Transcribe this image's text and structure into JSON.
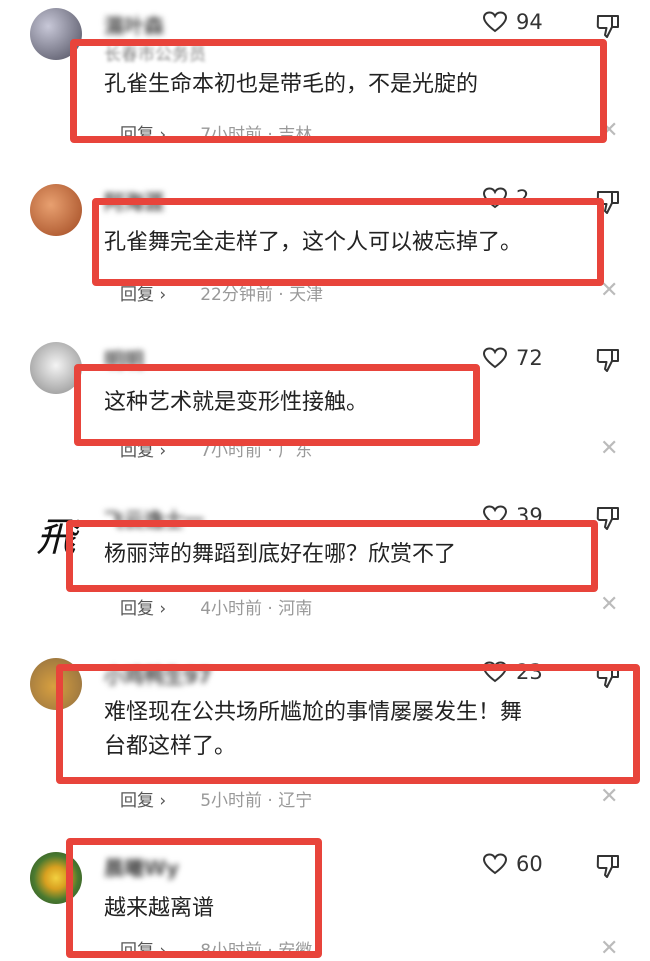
{
  "colors": {
    "highlight": "#e8443b",
    "text": "#222222",
    "meta": "#999999"
  },
  "icons": {
    "like": "heart-icon",
    "dislike": "thumbs-down-icon",
    "close": "close-icon",
    "reply_arrow": "chevron-right-icon"
  },
  "comments": [
    {
      "username": "濕叶森",
      "tag": "长春市公务员",
      "likes": "94",
      "text_lines": [
        "孔雀生命本初也是带毛的，不是光腚的"
      ],
      "reply_label": "回复 ›",
      "time": "7小时前",
      "location": "吉林"
    },
    {
      "username": "阿海涯",
      "tag": "",
      "likes": "2",
      "text_lines": [
        "孔雀舞完全走样了，这个人可以被忘掉了。"
      ],
      "reply_label": "回复 ›",
      "time": "22分钟前",
      "location": "天津"
    },
    {
      "username": "明明",
      "tag": "",
      "likes": "72",
      "text_lines": [
        "这种艺术就是变形性接触。"
      ],
      "reply_label": "回复 ›",
      "time": "7小时前",
      "location": "广东"
    },
    {
      "username": "飞云逸士一",
      "tag": "",
      "likes": "39",
      "text_lines": [
        "杨丽萍的舞蹈到底好在哪？欣赏不了"
      ],
      "reply_label": "回复 ›",
      "time": "4小时前",
      "location": "河南"
    },
    {
      "username": "小鸡鸭生97",
      "tag": "",
      "likes": "23",
      "text_lines": [
        "难怪现在公共场所尴尬的事情屡屡发生！舞",
        "台都这样了。"
      ],
      "reply_label": "回复 ›",
      "time": "5小时前",
      "location": "辽宁"
    },
    {
      "username": "晨曦Wy",
      "tag": "",
      "likes": "60",
      "text_lines": [
        "越来越离谱"
      ],
      "reply_label": "回复 ›",
      "time": "8小时前",
      "location": "安徽"
    }
  ]
}
